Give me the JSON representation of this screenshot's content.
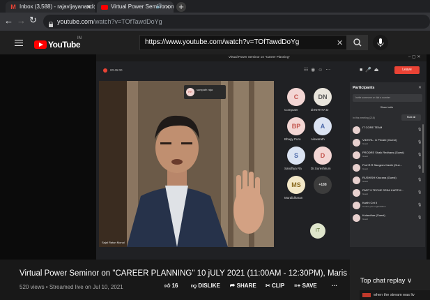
{
  "browser": {
    "tabs": [
      {
        "label": "Inbox (3,588) - rajavijayanand@g",
        "icon": "gmail-icon",
        "close": "✕"
      },
      {
        "label": "Virtual Power Seminor on \"C",
        "icon": "youtube-icon",
        "audio": "🔊",
        "close": "✕"
      }
    ],
    "new_tab": "+",
    "url_host": "youtube.com",
    "url_path": "/watch?v=TOfTawdDoYg"
  },
  "youtube": {
    "logo_text": "YouTube",
    "country": "IN",
    "search_value": "https://www.youtube.com/watch?v=TOfTawdDoYg",
    "search_clear": "✕"
  },
  "meet": {
    "window_title": "Virtual Power Seminor on \"Career Planning\"",
    "top_left_label": "00:45:00",
    "leave_label": "Leave",
    "pinned_name": "sampath raja",
    "speaker_label": "Sajal Ratan Monal",
    "tiles": [
      {
        "initials": "C",
        "name": "Computer",
        "bg": "#f3d6d4",
        "fg": "#c2534c"
      },
      {
        "initials": "DN",
        "name": "dr.NITHYA D",
        "bg": "#e9e5dc",
        "fg": "#555"
      },
      {
        "initials": "BP",
        "name": "Bhagy Puru",
        "bg": "#f3d6d4",
        "fg": "#c2534c"
      },
      {
        "initials": "A",
        "name": "Aiswarath",
        "bg": "#dbe3f2",
        "fg": "#4a67a8"
      },
      {
        "initials": "S",
        "name": "Sandhya Ra",
        "bg": "#dbe3f2",
        "fg": "#4a67a8"
      },
      {
        "initials": "D",
        "name": "Dr.Sureshkum",
        "bg": "#f3d6d4",
        "fg": "#c2534c"
      },
      {
        "initials": "MS",
        "name": "Muralidharan",
        "bg": "#f3e8c8",
        "fg": "#8a6a1f"
      },
      {
        "initials": "+188",
        "name": "",
        "bg": "#3c3c3c",
        "fg": "#ddd"
      }
    ],
    "panel_title": "Participants",
    "panel_search": "Invite someone or dial a number",
    "share_invite": "Share invite",
    "in_meeting": "In this meeting (218)",
    "mute_all": "Mute all",
    "participants": [
      {
        "name": "IT CORE TEAM",
        "sub": ""
      },
      {
        "name": "VIDHYA - in Private (Guest)",
        "sub": "Guest"
      },
      {
        "name": "PRODRE Shaik Redhans (Guest)",
        "sub": "Guest"
      },
      {
        "name": "Prof.R.R Sangeev Kanth (Gue...",
        "sub": "Guest"
      },
      {
        "name": "RUSHISH Khurana (Guest)",
        "sub": "Guest"
      },
      {
        "name": "PART II TECHE SRINI KARTHI...",
        "sub": "Guest"
      },
      {
        "name": "Karthi Cnt II",
        "sub": "Control your organization"
      },
      {
        "name": "Kulandhar (Guest)",
        "sub": "Guest"
      }
    ]
  },
  "video": {
    "title": "Virtual Power Seminor on \"CAREER PLANNING\" 10 jULY 2021 (11:00AM - 12:30PM), Maris Stella College.",
    "meta": "520 views • Streamed live on Jul 10, 2021",
    "likes": "16",
    "dislike_label": "DISLIKE",
    "share_label": "SHARE",
    "clip_label": "CLIP",
    "save_label": "SAVE",
    "more": "···"
  },
  "chat": {
    "label": "Top chat replay",
    "chevron": "∨",
    "message": "when the stream was liv"
  },
  "colors": {
    "yt_red": "#ff0000",
    "leave_red": "#ea4335",
    "meet_bg": "#202124"
  }
}
